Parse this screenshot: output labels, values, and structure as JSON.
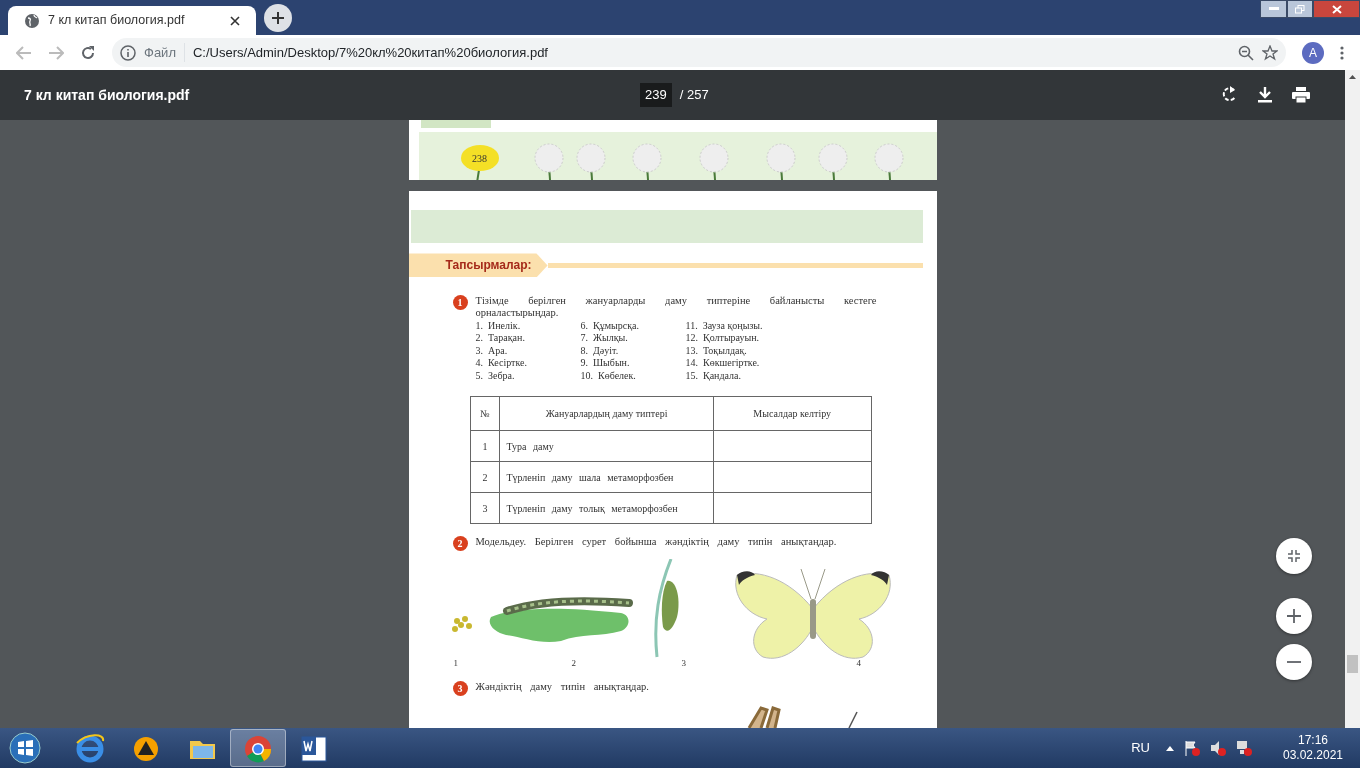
{
  "browser": {
    "tab_title": "7 кл китап биология.pdf",
    "address_prefix": "Файл",
    "url": "C:/Users/Admin/Desktop/7%20кл%20китап%20биология.pdf",
    "profile_initial": "A"
  },
  "pdf_toolbar": {
    "title": "7 кл китап биология.pdf",
    "current_page": "239",
    "total_pages": "/ 257"
  },
  "previous_page": {
    "page_number": "238"
  },
  "page": {
    "section_title": "Тапсырмалар:",
    "tasks": [
      {
        "number": "1",
        "text": "Тізімде берілген жануарларды даму типтеріне байланысты кестеге орналастырыңдар.",
        "items": [
          {
            "number": "1.",
            "text": "Инелік."
          },
          {
            "number": "2.",
            "text": "Тарақан."
          },
          {
            "number": "3.",
            "text": "Ара."
          },
          {
            "number": "4.",
            "text": "Кесіртке."
          },
          {
            "number": "5.",
            "text": "Зебра."
          },
          {
            "number": "6.",
            "text": "Құмырсқа."
          },
          {
            "number": "7.",
            "text": "Жылқы."
          },
          {
            "number": "8.",
            "text": "Дәуіт."
          },
          {
            "number": "9.",
            "text": "Шыбын."
          },
          {
            "number": "10.",
            "text": "Көбелек."
          },
          {
            "number": "11.",
            "text": "Зауза қоңызы."
          },
          {
            "number": "12.",
            "text": "Қолтырауын."
          },
          {
            "number": "13.",
            "text": "Тоқылдақ."
          },
          {
            "number": "14.",
            "text": "Көкшегіртке."
          },
          {
            "number": "15.",
            "text": "Қандала."
          }
        ],
        "table": {
          "columns": [
            "№",
            "Жануарлардың даму типтері",
            "Мысалдар келтіру"
          ],
          "rows": [
            {
              "number": "1",
              "type": "Тура даму"
            },
            {
              "number": "2",
              "type": "Түрленіп даму шала метаморфозбен"
            },
            {
              "number": "3",
              "type": "Түрленіп даму толық метаморфозбен"
            }
          ]
        }
      },
      {
        "number": "2",
        "text": "Модельдеу. Берілген сурет бойынша жәндіктің даму типін анықтаңдар.",
        "figure_labels": [
          "1",
          "2",
          "3",
          "4"
        ]
      },
      {
        "number": "3",
        "text": "Жәндіктің даму типін анықтаңдар."
      }
    ]
  },
  "taskbar": {
    "language": "RU",
    "time": "17:16",
    "date": "03.02.2021"
  }
}
